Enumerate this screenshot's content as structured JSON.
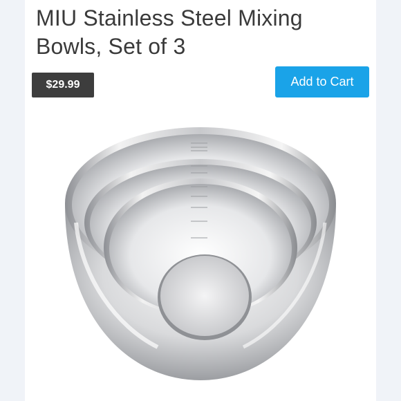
{
  "product": {
    "title": "MIU Stainless Steel Mixing Bowls, Set of 3",
    "price": "$29.99",
    "add_to_cart_label": "Add to Cart",
    "image_icon": "mixing-bowls-photo"
  },
  "colors": {
    "price_badge_bg": "#3d3d3d",
    "button_bg": "#1aa3e8",
    "title_text": "#3a3a3a"
  }
}
